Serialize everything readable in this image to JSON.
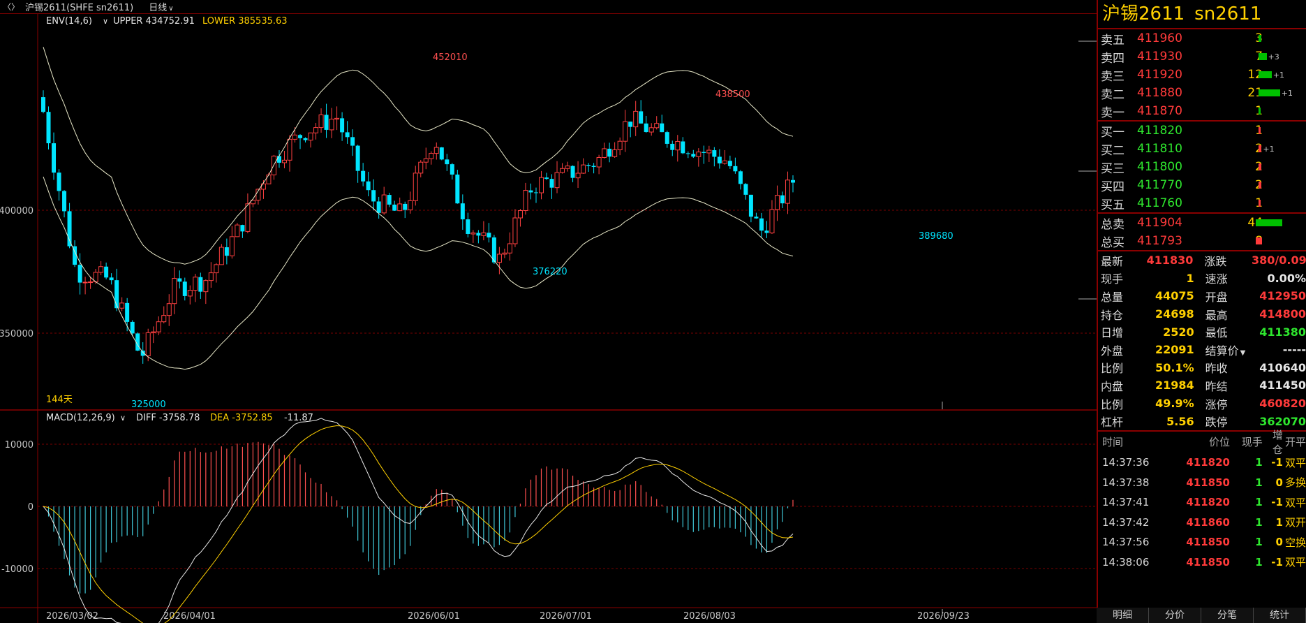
{
  "window": {
    "title": "沪锡2611(SHFE sn2611)",
    "period": "日线",
    "menu_icon": "chart-menu-icon"
  },
  "main_chart": {
    "indicator_label": "ENV(14,6)",
    "upper_label": "UPPER 434752.91",
    "lower_label": "LOWER 385535.63",
    "y_ticks": [
      "400000",
      "350000"
    ],
    "days_label": "144天",
    "annotations": [
      "452010",
      "438500",
      "376220",
      "325000",
      "389680"
    ],
    "colors": {
      "up": "#ff4040",
      "down": "#00e5ff",
      "band": "#e8e8c8",
      "grid": "#7a0000"
    }
  },
  "macd_panel": {
    "label": "MACD(12,26,9)",
    "diff_label": "DIFF -3758.78",
    "dea_label": "DEA -3752.85",
    "macd_value": "-11.87",
    "y_ticks": [
      "10000",
      "0",
      "-10000"
    ]
  },
  "x_axis": {
    "dates": [
      "2026/03/02",
      "2026/04/01",
      "2026/06/01",
      "2026/07/01",
      "2026/08/03",
      "2026/09/23"
    ]
  },
  "chart_data": {
    "type": "candlestick",
    "x_labels": [
      "2026/03/02",
      "2026/04/01",
      "2026/06/01",
      "2026/07/01",
      "2026/08/03",
      "2026/09/23"
    ],
    "y_ticks": [
      400000,
      350000
    ],
    "ylim": [
      320000,
      470000
    ],
    "highest": 452010,
    "lowest": 325000,
    "local_high": 438500,
    "local_low_1": 376220,
    "local_low_2": 389680,
    "envelope": {
      "upper": 434752.91,
      "lower": 385535.63
    },
    "ohlc_close_samples": [
      440000,
      375000,
      372000,
      340000,
      368000,
      372000,
      392000,
      420000,
      432000,
      438000,
      405000,
      398000,
      430000,
      395000,
      380000,
      410000,
      414000,
      420000,
      437000,
      430000,
      425000,
      420000,
      391000,
      412000
    ],
    "macd": {
      "diff": -3758.78,
      "dea": -3752.85,
      "hist": -11.87,
      "ylim": [
        -15000,
        13000
      ]
    }
  },
  "symbol_panel": {
    "name": "沪锡2611",
    "code": "sn2611",
    "asks": [
      {
        "label": "卖五",
        "price": "411960",
        "vol": "3",
        "chg": "",
        "bar": 2
      },
      {
        "label": "卖四",
        "price": "411930",
        "vol": "7",
        "chg": "+3",
        "bar": 8
      },
      {
        "label": "卖三",
        "price": "411920",
        "vol": "12",
        "chg": "+1",
        "bar": 14
      },
      {
        "label": "卖二",
        "price": "411880",
        "vol": "21",
        "chg": "+1",
        "bar": 24
      },
      {
        "label": "卖一",
        "price": "411870",
        "vol": "1",
        "chg": "",
        "bar": 1
      }
    ],
    "bids": [
      {
        "label": "买一",
        "price": "411820",
        "vol": "1",
        "chg": "",
        "bar": 1
      },
      {
        "label": "买二",
        "price": "411810",
        "vol": "2",
        "chg": "+1",
        "bar": 2
      },
      {
        "label": "买三",
        "price": "411800",
        "vol": "2",
        "chg": "",
        "bar": 2
      },
      {
        "label": "买四",
        "price": "411770",
        "vol": "2",
        "chg": "",
        "bar": 2
      },
      {
        "label": "买五",
        "price": "411760",
        "vol": "1",
        "chg": "",
        "bar": 1
      }
    ],
    "totals": [
      {
        "label": "总卖",
        "price": "411904",
        "vol": "44",
        "bar": 30,
        "barcolor": "#00c000"
      },
      {
        "label": "总买",
        "price": "411793",
        "vol": "8",
        "bar": 6,
        "barcolor": "#ff3a3a"
      }
    ],
    "stats": [
      {
        "k": "最新",
        "v": "411830",
        "vc": "red",
        "k2": "涨跌",
        "v2": "380/0.09%",
        "v2c": "red"
      },
      {
        "k": "现手",
        "v": "1",
        "vc": "yellow",
        "k2": "速涨",
        "v2": "0.00%",
        "v2c": "white"
      },
      {
        "k": "总量",
        "v": "44075",
        "vc": "yellow",
        "k2": "开盘",
        "v2": "412950",
        "v2c": "red"
      },
      {
        "k": "持仓",
        "v": "24698",
        "vc": "yellow",
        "k2": "最高",
        "v2": "414800",
        "v2c": "red"
      },
      {
        "k": "日增",
        "v": "2520",
        "vc": "yellow",
        "k2": "最低",
        "v2": "411380",
        "v2c": "green"
      },
      {
        "k": "外盘",
        "v": "22091",
        "vc": "yellow",
        "k2": "结算价",
        "v2": "-----",
        "v2c": "white"
      },
      {
        "k": "比例",
        "v": "50.1%",
        "vc": "yellow",
        "k2": "昨收",
        "v2": "410640",
        "v2c": "white"
      },
      {
        "k": "内盘",
        "v": "21984",
        "vc": "yellow",
        "k2": "昨结",
        "v2": "411450",
        "v2c": "white"
      },
      {
        "k": "比例",
        "v": "49.9%",
        "vc": "yellow",
        "k2": "涨停",
        "v2": "460820",
        "v2c": "red"
      },
      {
        "k": "杠杆",
        "v": "5.56",
        "vc": "yellow",
        "k2": "跌停",
        "v2": "362070",
        "v2c": "green"
      }
    ],
    "ticks_header": [
      "时间",
      "价位",
      "现手",
      "增仓",
      "开平"
    ],
    "ticks": [
      {
        "t": "14:37:36",
        "p": "411820",
        "pc": "red",
        "h": "1",
        "z": "-1",
        "o": "双平"
      },
      {
        "t": "14:37:38",
        "p": "411850",
        "pc": "red",
        "h": "1",
        "z": "0",
        "o": "多换"
      },
      {
        "t": "14:37:41",
        "p": "411820",
        "pc": "red",
        "h": "1",
        "z": "-1",
        "o": "双平"
      },
      {
        "t": "14:37:42",
        "p": "411860",
        "pc": "red",
        "h": "1",
        "z": "1",
        "o": "双开"
      },
      {
        "t": "14:37:56",
        "p": "411850",
        "pc": "red",
        "h": "1",
        "z": "0",
        "o": "空换"
      },
      {
        "t": "14:38:06",
        "p": "411850",
        "pc": "red",
        "h": "1",
        "z": "-1",
        "o": "双平"
      }
    ],
    "tabs": [
      "明细",
      "分价",
      "分笔",
      "统计"
    ]
  }
}
